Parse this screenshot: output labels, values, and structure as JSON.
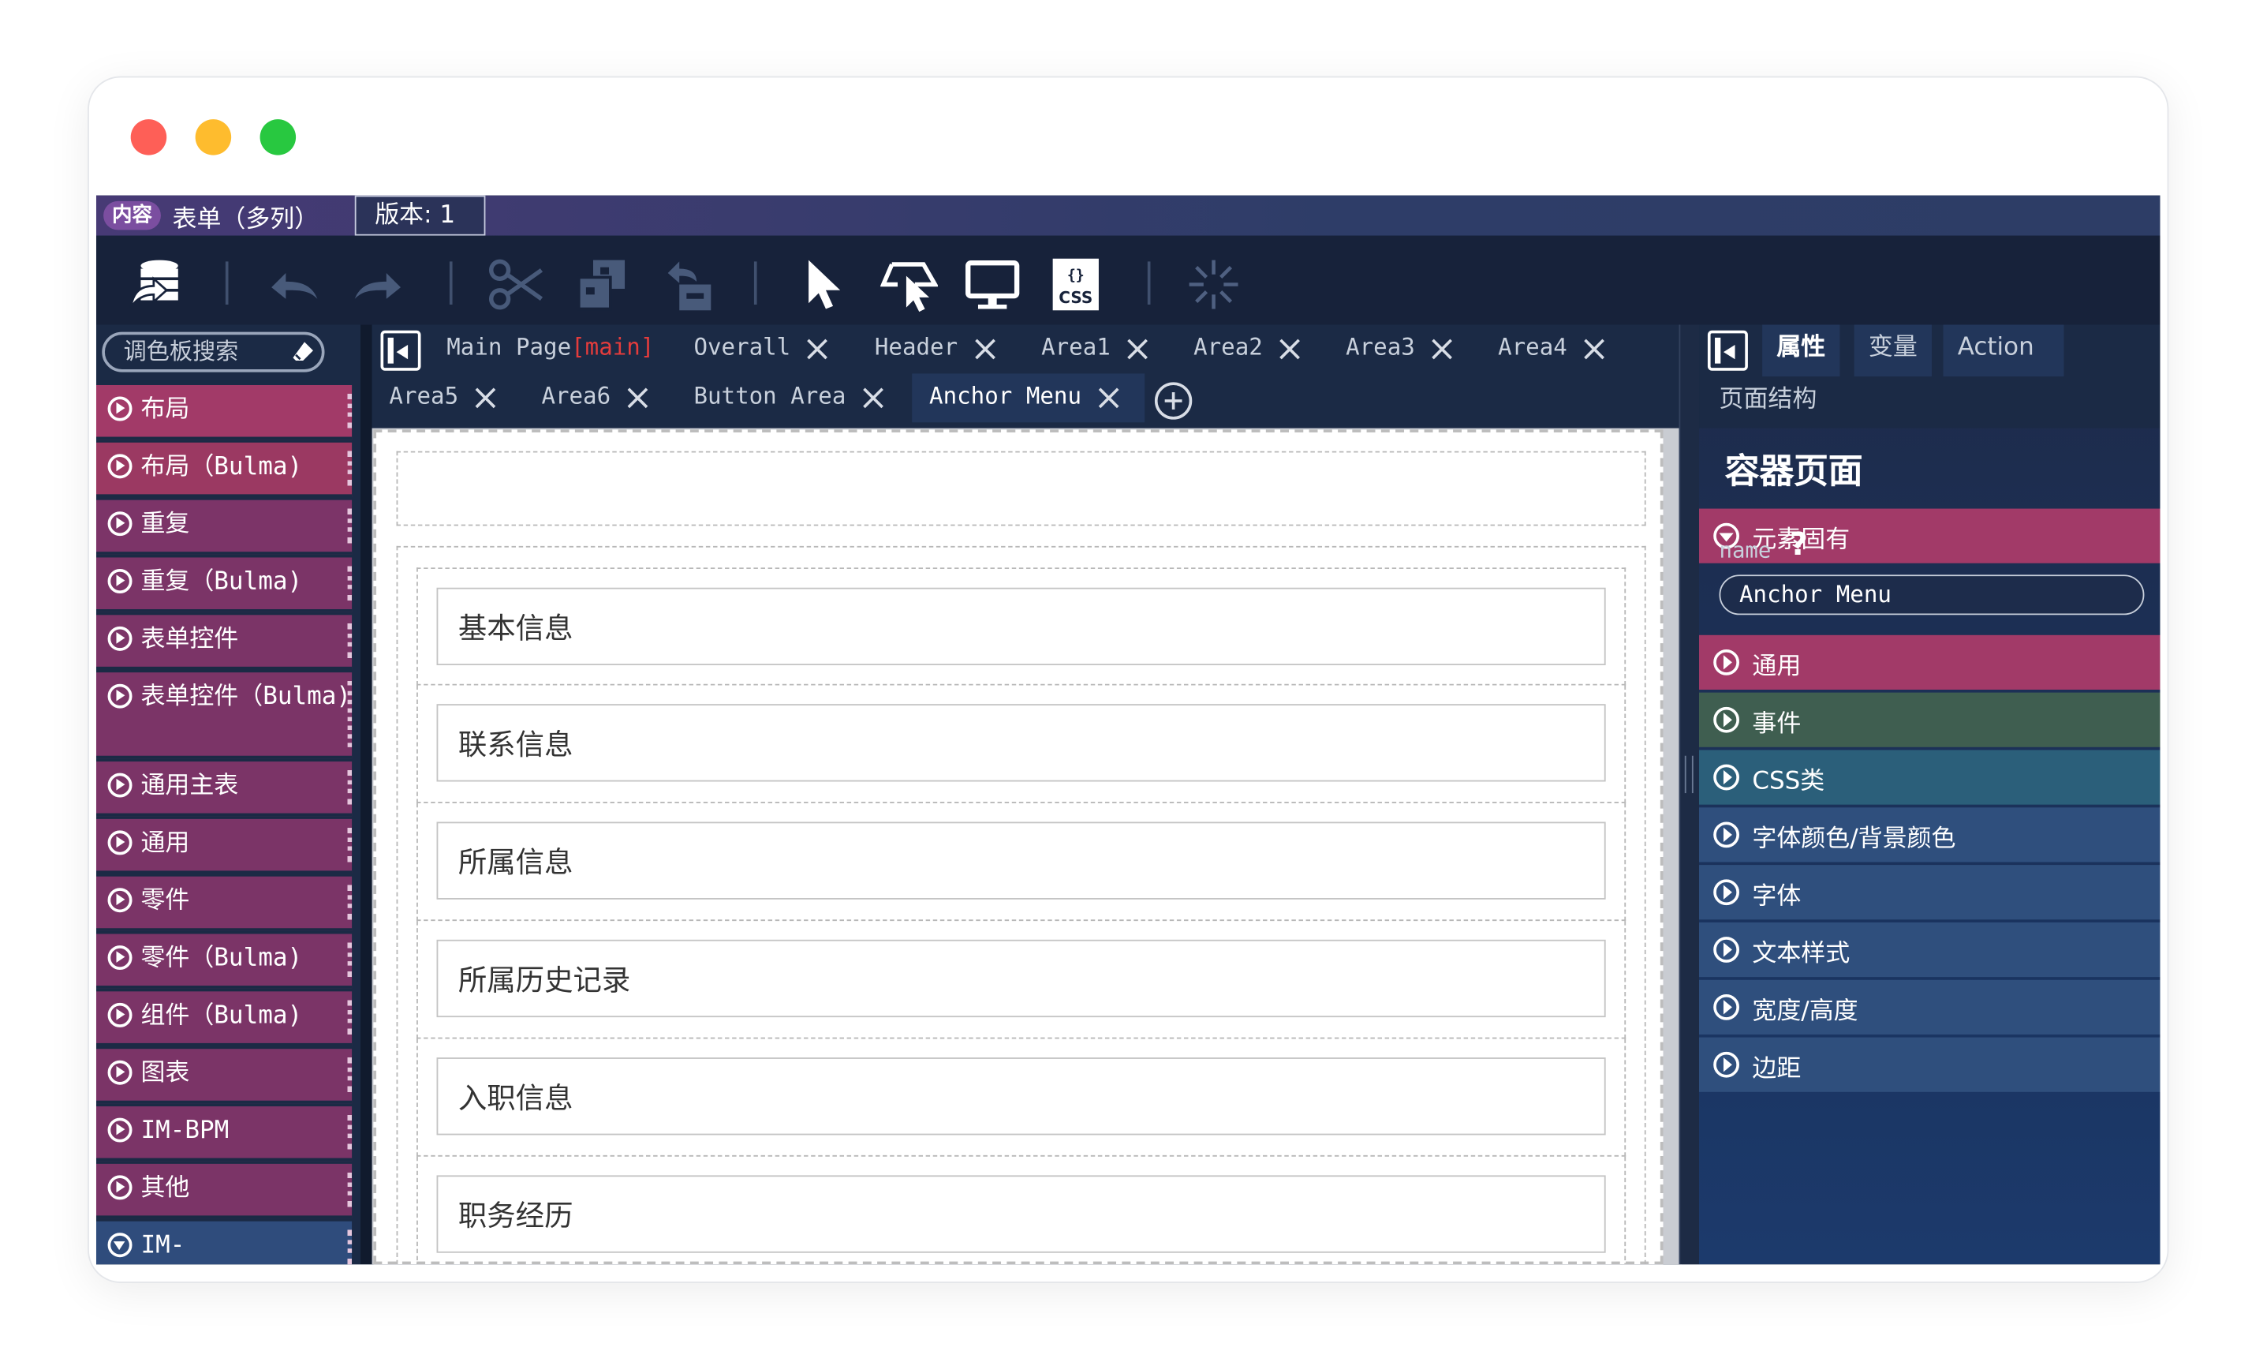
{
  "window": {
    "buttons": [
      "close",
      "minimize",
      "maximize"
    ]
  },
  "topbar": {
    "badge": "内容",
    "form_title": "表单（多列）",
    "version": "版本: 1"
  },
  "toolbar": {
    "icons": [
      "database-export-icon",
      "undo-icon",
      "redo-icon",
      "cut-icon",
      "copy-icon",
      "paste-icon",
      "select-pointer-icon",
      "select-parent-icon",
      "preview-monitor-icon",
      "css-file-icon",
      "loading-spinner-icon"
    ],
    "css_label": "CSS"
  },
  "palette": {
    "search_placeholder": "调色板搜索",
    "items": [
      {
        "label": "布局",
        "color": "#a23a68"
      },
      {
        "label": "布局（Bulma)",
        "color": "#9b3962"
      },
      {
        "label": "重复",
        "color": "#7c3468"
      },
      {
        "label": "重复（Bulma)",
        "color": "#7b3467"
      },
      {
        "label": "表单控件",
        "color": "#7b3467"
      },
      {
        "label": "表单控件（Bulma)",
        "color": "#7b3467"
      },
      {
        "label": "通用主表",
        "color": "#7b3467"
      },
      {
        "label": "通用",
        "color": "#7b3467"
      },
      {
        "label": "零件",
        "color": "#7b3467"
      },
      {
        "label": "零件（Bulma)",
        "color": "#7b3467"
      },
      {
        "label": "组件（Bulma)",
        "color": "#7b3467"
      },
      {
        "label": "图表",
        "color": "#7b3467"
      },
      {
        "label": "IM-BPM",
        "color": "#7b3467"
      },
      {
        "label": "其他",
        "color": "#7b3467"
      },
      {
        "label": "IM-",
        "color": "#2f4c7c"
      }
    ]
  },
  "tabs": {
    "row1": [
      {
        "label": "Main Page",
        "suffix": "[main]"
      },
      {
        "label": "Overall"
      },
      {
        "label": "Header"
      },
      {
        "label": "Area1"
      },
      {
        "label": "Area2"
      },
      {
        "label": "Area3"
      },
      {
        "label": "Area4"
      }
    ],
    "row2": [
      {
        "label": "Area5"
      },
      {
        "label": "Area6"
      },
      {
        "label": "Button Area"
      },
      {
        "label": "Anchor Menu"
      }
    ],
    "active": "Anchor Menu"
  },
  "canvas": {
    "sections": [
      "基本信息",
      "联系信息",
      "所属信息",
      "所属历史记录",
      "入职信息",
      "职务经历"
    ]
  },
  "right_panel": {
    "tabs": [
      "属性",
      "变量",
      "Action",
      "页面结构"
    ],
    "active_tab": "属性",
    "header": "容器页面",
    "inherent": {
      "label": "元素固有",
      "color": "#a23a68"
    },
    "name_label": "name",
    "help": "?",
    "name_value": "Anchor Menu",
    "properties": [
      {
        "label": "通用",
        "color": "#a23a68"
      },
      {
        "label": "事件",
        "color": "#3f5e50"
      },
      {
        "label": "CSS类",
        "color": "#2b5f7a"
      },
      {
        "label": "字体颜色/背景颜色",
        "color": "#2f4f7d"
      },
      {
        "label": "字体",
        "color": "#2f4f7d"
      },
      {
        "label": "文本样式",
        "color": "#2f4f7d"
      },
      {
        "label": "宽度/高度",
        "color": "#2f4f7d"
      },
      {
        "label": "边距",
        "color": "#2f4f7d"
      }
    ]
  }
}
